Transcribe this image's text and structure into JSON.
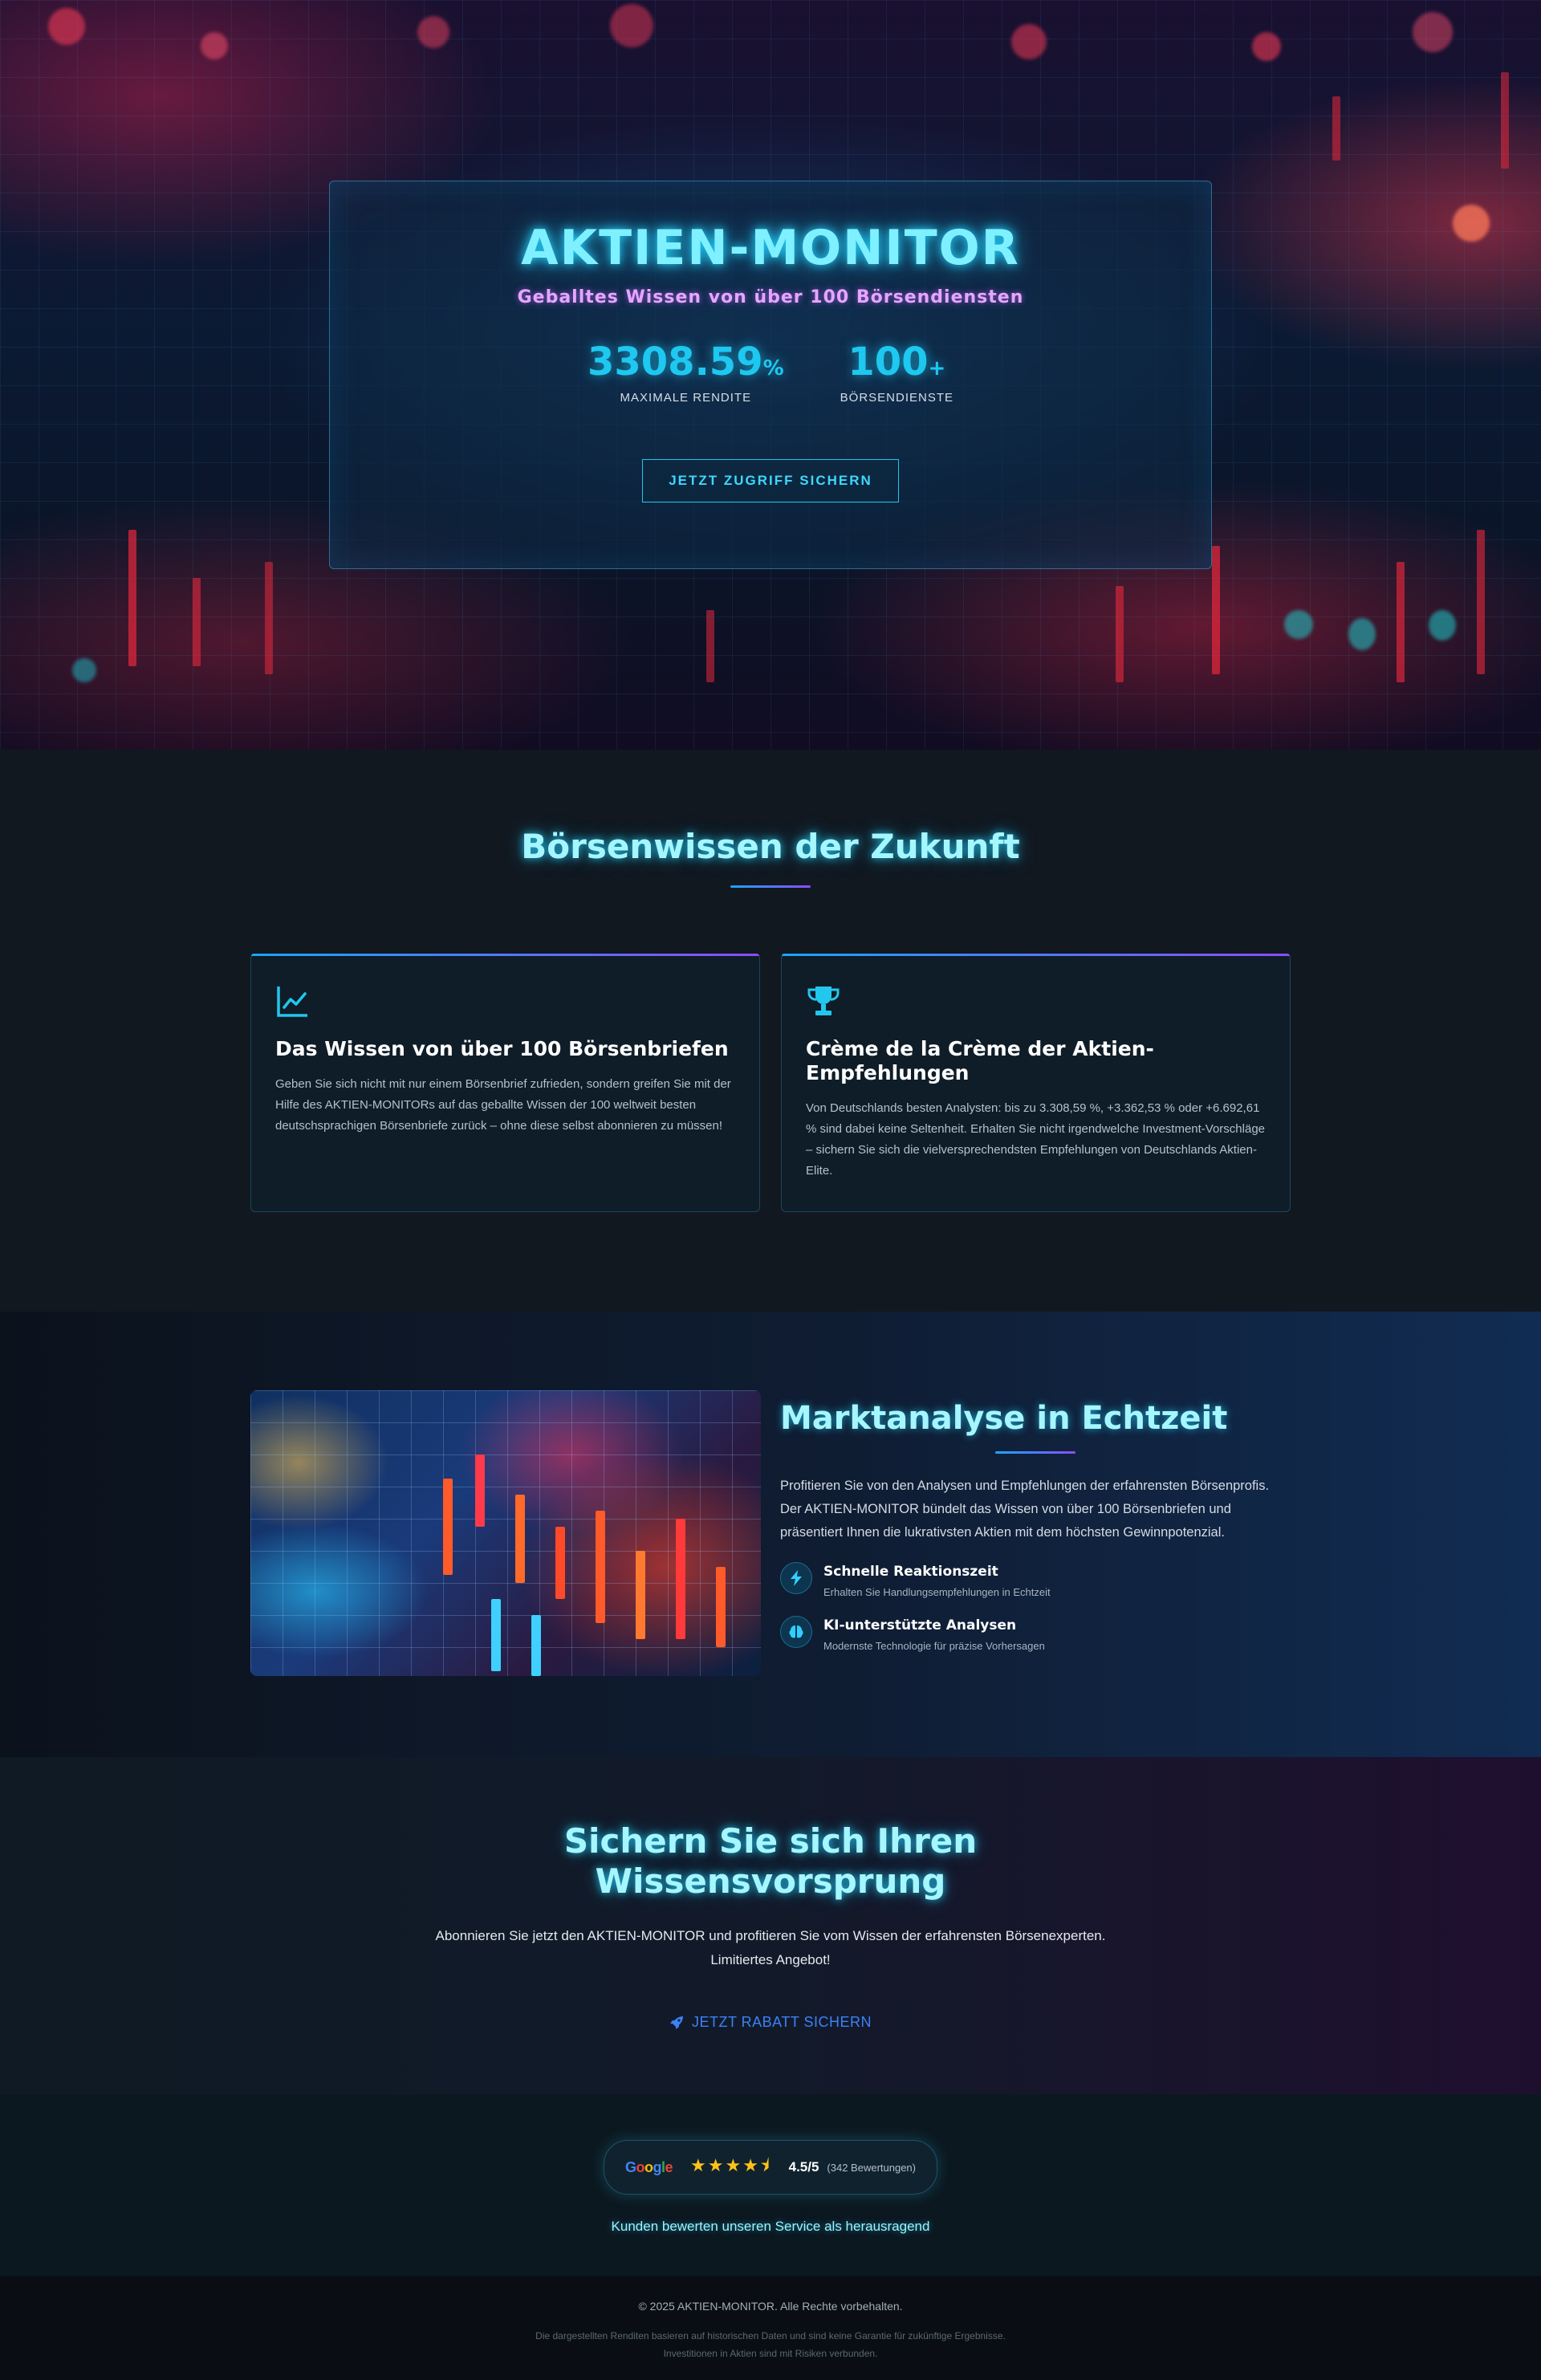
{
  "hero": {
    "title": "AKTIEN-MONITOR",
    "subtitle": "Geballtes Wissen von über 100 Börsendiensten",
    "stats": [
      {
        "value": "3308.59",
        "unit": "%",
        "label": "MAXIMALE RENDITE"
      },
      {
        "value": "100",
        "unit": "+",
        "label": "BÖRSENDIENSTE"
      }
    ],
    "cta_label": "JETZT ZUGRIFF SICHERN"
  },
  "features": {
    "title": "Börsenwissen der Zukunft",
    "cards": [
      {
        "icon": "chart-line-icon",
        "title": "Das Wissen von über 100 Börsenbriefen",
        "text": "Geben Sie sich nicht mit nur einem Börsenbrief zufrieden, sondern greifen Sie mit der Hilfe des AKTIEN-MONITORs auf das geballte Wissen der 100 weltweit besten deutschsprachigen Börsenbriefe zurück – ohne diese selbst abonnieren zu müssen!"
      },
      {
        "icon": "trophy-icon",
        "title": "Crème de la Crème der Aktien-Empfehlungen",
        "text": "Von Deutschlands besten Analysten: bis zu 3.308,59 %, +3.362,53 % oder +6.692,61 % sind dabei keine Seltenheit. Erhalten Sie nicht irgendwelche Investment-Vorschläge – sichern Sie sich die vielversprechendsten Empfehlungen von Deutschlands Aktien-Elite."
      }
    ]
  },
  "market": {
    "title": "Marktanalyse in Echtzeit",
    "description": "Profitieren Sie von den Analysen und Empfehlungen der erfahrensten Börsenprofis. Der AKTIEN-MONITOR bündelt das Wissen von über 100 Börsenbriefen und präsentiert Ihnen die lukrativsten Aktien mit dem höchsten Gewinnpotenzial.",
    "bullets": [
      {
        "icon": "lightning-icon",
        "title": "Schnelle Reaktionszeit",
        "subtitle": "Erhalten Sie Handlungsempfehlungen in Echtzeit"
      },
      {
        "icon": "brain-icon",
        "title": "KI-unterstützte Analysen",
        "subtitle": "Modernste Technologie für präzise Vorhersagen"
      }
    ]
  },
  "cta": {
    "title_line1": "Sichern Sie sich Ihren",
    "title_line2": "Wissensvorsprung",
    "text": "Abonnieren Sie jetzt den AKTIEN-MONITOR und profitieren Sie vom Wissen der erfahrensten Börsenexperten. Limitiertes Angebot!",
    "button_label": "JETZT RABATT SICHERN",
    "button_icon": "rocket-icon"
  },
  "rating": {
    "provider": "Google",
    "stars": "★★★★⯨",
    "score": "4.5/5",
    "count": "(342 Bewertungen)",
    "note": "Kunden bewerten unseren Service als herausragend"
  },
  "footer": {
    "copyright": "© 2025 AKTIEN-MONITOR. Alle Rechte vorbehalten.",
    "disclaimer": "Die dargestellten Renditen basieren auf historischen Daten und sind keine Garantie für zukünftige Ergebnisse. Investitionen in Aktien sind mit Risiken verbunden."
  },
  "colors": {
    "accent_cyan": "#22d3ff",
    "accent_purple": "#8a4dff",
    "cta_blue": "#3b82f6",
    "star_gold": "#ffc21a"
  }
}
